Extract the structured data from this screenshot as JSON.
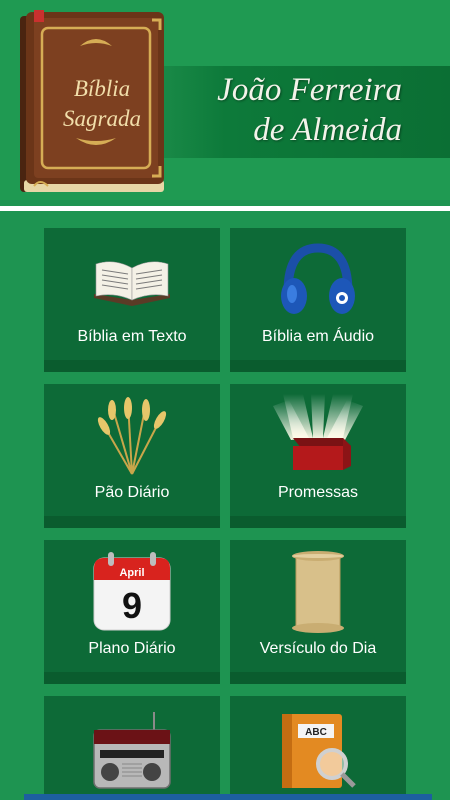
{
  "header": {
    "logo_line1": "Bíblia",
    "logo_line2": "Sagrada",
    "title_line1": "João Ferreira",
    "title_line2": "de Almeida"
  },
  "tiles": [
    {
      "label": "Bíblia em Texto",
      "icon": "open-bible-icon"
    },
    {
      "label": "Bíblia em Áudio",
      "icon": "headphones-icon"
    },
    {
      "label": "Pão Diário",
      "icon": "wheat-icon"
    },
    {
      "label": "Promessas",
      "icon": "glowing-box-icon"
    },
    {
      "label": "Plano Diário",
      "icon": "calendar-icon"
    },
    {
      "label": "Versículo do Dia",
      "icon": "scroll-icon"
    },
    {
      "label": "",
      "icon": "radio-icon"
    },
    {
      "label": "",
      "icon": "dictionary-icon"
    }
  ],
  "calendar": {
    "month": "April",
    "day": "9"
  },
  "dictionary": {
    "cover_text": "ABC"
  },
  "colors": {
    "background": "#1e9451",
    "tile": "#0d6a37",
    "title_band": "#0b6f34",
    "book": "#6b3518"
  }
}
